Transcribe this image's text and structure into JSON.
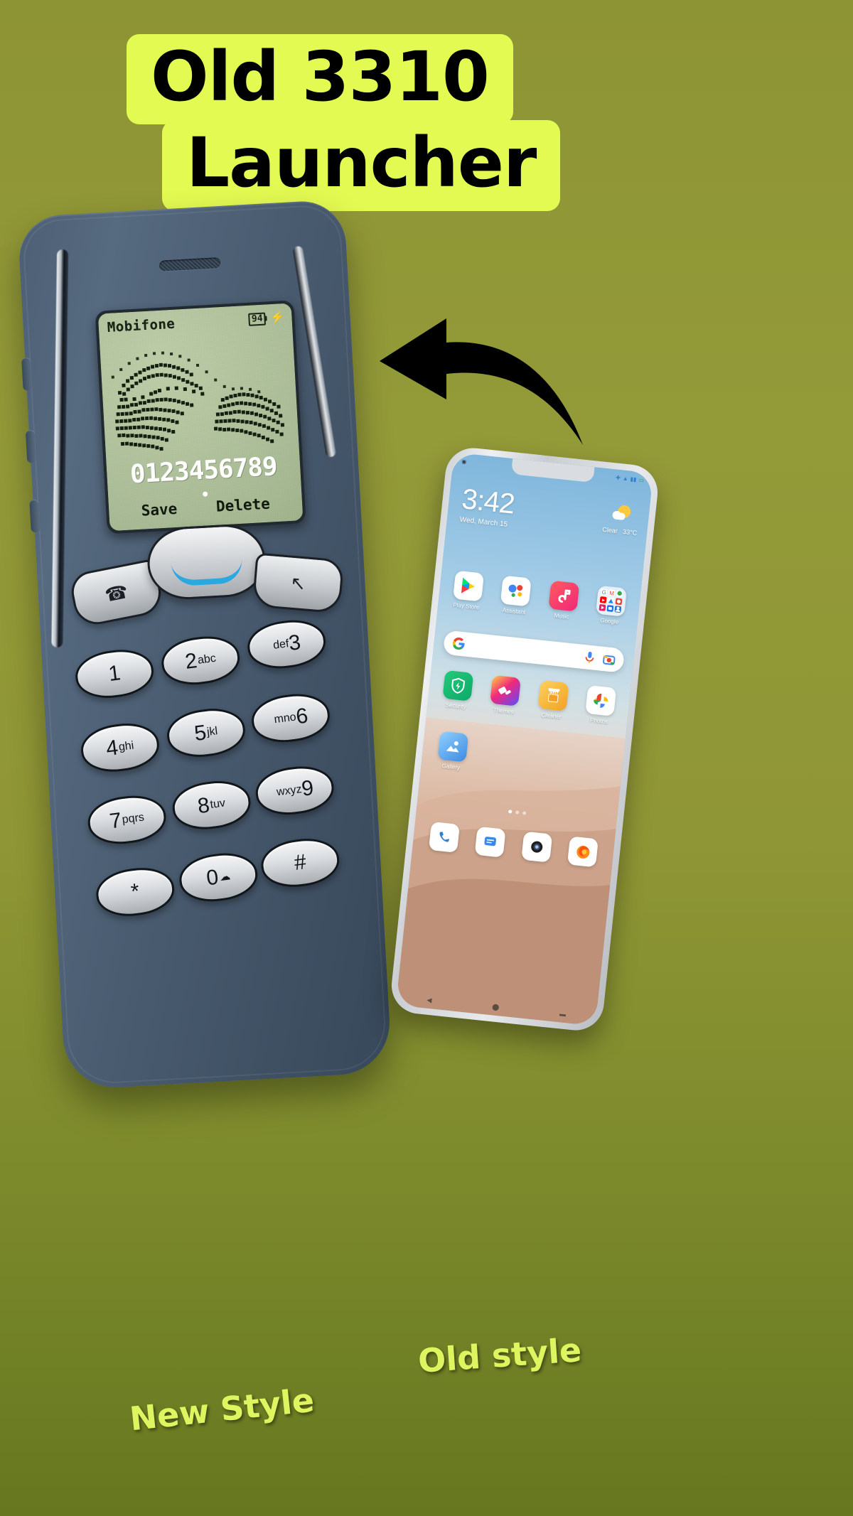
{
  "theme": {
    "background_top": "#8d9434",
    "background_bottom": "#66771f",
    "title_pill_bg": "#e3fa52",
    "title_text_color": "#000000",
    "caption_color": "#dff55f",
    "lcd_bg": "#b6c8a2",
    "lcd_ink": "#1b2417",
    "nokia_body": "#4a5c70",
    "nav_accent": "#2aa8e0"
  },
  "title": {
    "line1": "Old 3310",
    "line2": "Launcher"
  },
  "captions": {
    "new_style": "New Style",
    "old_style": "Old style"
  },
  "arrow": {
    "name": "curved-arrow-pointing-left",
    "color": "#000000"
  },
  "nokia": {
    "lcd": {
      "carrier": "Mobifone",
      "battery_level": "94",
      "charging_icon": "⚡",
      "dialed_number": "0123456789",
      "softkey_left": "Save",
      "softkey_right": "Delete",
      "center_dot": "•",
      "wallpaper": "dithered-handshake-pixel-art"
    },
    "nav": {
      "left_key_icon": "☎",
      "right_key_icon": "↖",
      "center_key_label": ""
    },
    "keys": [
      {
        "digit": "1",
        "letters": ""
      },
      {
        "digit": "2",
        "letters": "abc"
      },
      {
        "digit": "3",
        "letters": "def",
        "letters_first": true
      },
      {
        "digit": "4",
        "letters": "ghi"
      },
      {
        "digit": "5",
        "letters": "jkl"
      },
      {
        "digit": "6",
        "letters": "mno",
        "letters_first": true
      },
      {
        "digit": "7",
        "letters": "pqrs"
      },
      {
        "digit": "8",
        "letters": "tuv"
      },
      {
        "digit": "9",
        "letters": "wxyz",
        "letters_first": true
      },
      {
        "digit": "*",
        "letters": ""
      },
      {
        "digit": "0",
        "letters": "",
        "bulb": "☁"
      },
      {
        "digit": "#",
        "letters": ""
      }
    ]
  },
  "modern_phone": {
    "status_bar": {
      "left_icons": [
        "location-icon"
      ],
      "right_icons": [
        "bluetooth-icon",
        "wifi-icon",
        "signal-icon",
        "battery-icon"
      ]
    },
    "clock": "3:42",
    "date": "Wed, March 15",
    "weather": {
      "condition": "Clear",
      "temperature": "33°C",
      "icon": "sun-cloud-icon"
    },
    "row1": [
      {
        "label": "Play Store",
        "icon": "play-store-icon"
      },
      {
        "label": "Assistant",
        "icon": "google-assistant-icon"
      },
      {
        "label": "Music",
        "icon": "music-note-icon"
      },
      {
        "label": "Google",
        "icon": "google-folder-icon"
      }
    ],
    "search": {
      "placeholder": "",
      "left_icon": "google-g-icon",
      "mic_icon": "microphone-icon",
      "lens_icon": "google-lens-icon"
    },
    "row2": [
      {
        "label": "Security",
        "icon": "security-shield-icon"
      },
      {
        "label": "Themes",
        "icon": "themes-icon"
      },
      {
        "label": "Cleaner",
        "icon": "cleaner-icon",
        "badge": "834M"
      },
      {
        "label": "Photos",
        "icon": "google-photos-icon"
      }
    ],
    "row3": [
      {
        "label": "Gallery",
        "icon": "gallery-icon"
      }
    ],
    "page_dots": {
      "count": 3,
      "active_index": 0
    },
    "dock": [
      {
        "label": "",
        "icon": "phone-icon"
      },
      {
        "label": "",
        "icon": "messages-icon"
      },
      {
        "label": "",
        "icon": "camera-icon"
      },
      {
        "label": "",
        "icon": "firefox-icon"
      }
    ],
    "nav_bar": [
      "back-icon",
      "home-icon",
      "recents-icon"
    ]
  }
}
